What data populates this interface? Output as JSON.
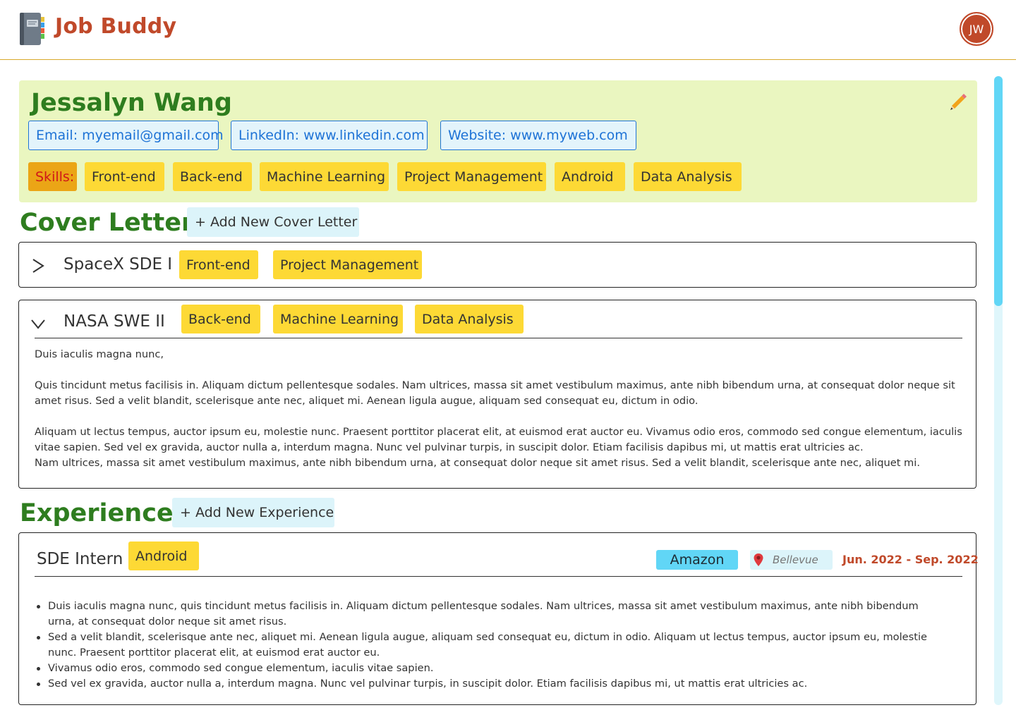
{
  "app": {
    "title": "Job Buddy",
    "logo_icon": "notebook-icon"
  },
  "user": {
    "initials": "JW"
  },
  "profile": {
    "name": "Jessalyn Wang",
    "edit_icon": "pencil-icon",
    "contacts": {
      "email": "Email: myemail@gmail.com",
      "linkedin": "LinkedIn: www.linkedin.com",
      "website": "Website: www.myweb.com"
    },
    "skills_label": "Skills:",
    "skills": [
      "Front-end",
      "Back-end",
      "Machine Learning",
      "Project Management",
      "Android",
      "Data Analysis"
    ]
  },
  "cover_letters": {
    "title": "Cover Letters",
    "add_label": "+ Add New Cover Letter",
    "items": [
      {
        "title": "SpaceX SDE I",
        "expanded": false,
        "tags": [
          "Front-end",
          "Project Management"
        ]
      },
      {
        "title": "NASA SWE II",
        "expanded": true,
        "tags": [
          "Back-end",
          "Machine Learning",
          "Data Analysis"
        ],
        "paragraphs": [
          "Duis iaculis magna nunc,",
          "Quis tincidunt metus facilisis in. Aliquam dictum pellentesque sodales. Nam ultrices, massa sit amet vestibulum maximus, ante nibh bibendum urna, at consequat dolor neque sit amet risus. Sed a velit blandit, scelerisque ante nec, aliquet mi. Aenean ligula augue, aliquam sed consequat eu, dictum in odio.",
          "Aliquam ut lectus tempus, auctor ipsum eu, molestie nunc. Praesent porttitor placerat elit, at euismod erat auctor eu. Vivamus odio eros, commodo sed congue elementum, iaculis vitae sapien. Sed vel ex gravida, auctor nulla a, interdum magna. Nunc vel pulvinar turpis, in suscipit dolor. Etiam facilisis dapibus mi, ut mattis erat ultricies ac.",
          "Nam ultrices, massa sit amet vestibulum maximus, ante nibh bibendum urna, at consequat dolor neque sit amet risus. Sed a velit blandit, scelerisque ante nec, aliquet mi."
        ]
      }
    ]
  },
  "experiences": {
    "title": "Experiences",
    "add_label": "+ Add New Experience",
    "items": [
      {
        "title": "SDE Intern",
        "tags": [
          "Android"
        ],
        "company": "Amazon",
        "location": "Bellevue",
        "dates": "Jun. 2022 - Sep. 2022",
        "bullets": [
          "Duis iaculis magna nunc, quis tincidunt metus facilisis in. Aliquam dictum pellentesque sodales. Nam ultrices, massa sit amet vestibulum maximus, ante nibh bibendum urna, at consequat dolor neque sit amet risus.",
          "Sed a velit blandit, scelerisque ante nec, aliquet mi. Aenean ligula augue, aliquam sed consequat eu, dictum in odio. Aliquam ut lectus tempus, auctor ipsum eu, molestie nunc. Praesent porttitor placerat elit, at euismod erat auctor eu.",
          "Vivamus odio eros, commodo sed congue elementum, iaculis vitae sapien.",
          "Sed vel ex gravida, auctor nulla a, interdum magna. Nunc vel pulvinar turpis, in suscipit dolor. Etiam facilisis dapibus mi, ut mattis erat ultricies ac."
        ]
      }
    ]
  },
  "colors": {
    "brand": "#c0492a",
    "section_title": "#2e7d1f",
    "profile_bg": "#eaf6c0",
    "tag_yellow": "#fdd935",
    "skills_label_bg": "#eba516",
    "link_blue": "#1e73d6",
    "company_badge": "#61d6f6",
    "scrollbar": "#61d6f6"
  }
}
